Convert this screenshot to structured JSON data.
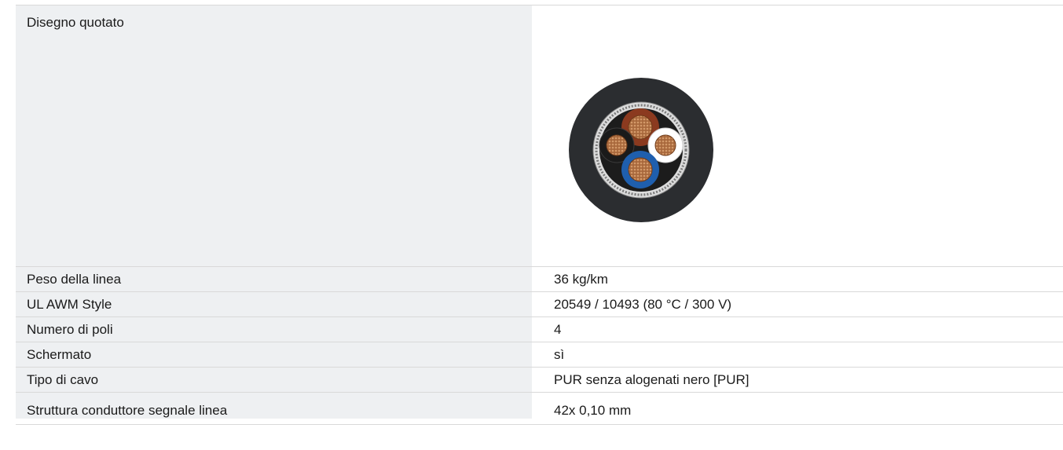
{
  "spec_table": {
    "drawing_row": {
      "label": "Disegno quotato",
      "image_icon": "cable-cross-section-icon",
      "colors": {
        "jacket": "#2b2d30",
        "core_brown": "#8b3a1f",
        "core_white": "#ffffff",
        "core_blue": "#1f5fae",
        "core_black": "#1c1c1c",
        "copper": "#b87a4a",
        "shield": "#c9c9c9"
      }
    },
    "rows": [
      {
        "label": "Peso della linea",
        "value": "36 kg/km"
      },
      {
        "label": "UL AWM Style",
        "value": "20549 / 10493 (80 °C / 300 V)"
      },
      {
        "label": "Numero di poli",
        "value": "4"
      },
      {
        "label": "Schermato",
        "value": "sì"
      },
      {
        "label": "Tipo di cavo",
        "value": "PUR senza alogenati nero [PUR]"
      },
      {
        "label": "Struttura conduttore segnale linea",
        "value": "42x 0,10 mm"
      }
    ]
  }
}
